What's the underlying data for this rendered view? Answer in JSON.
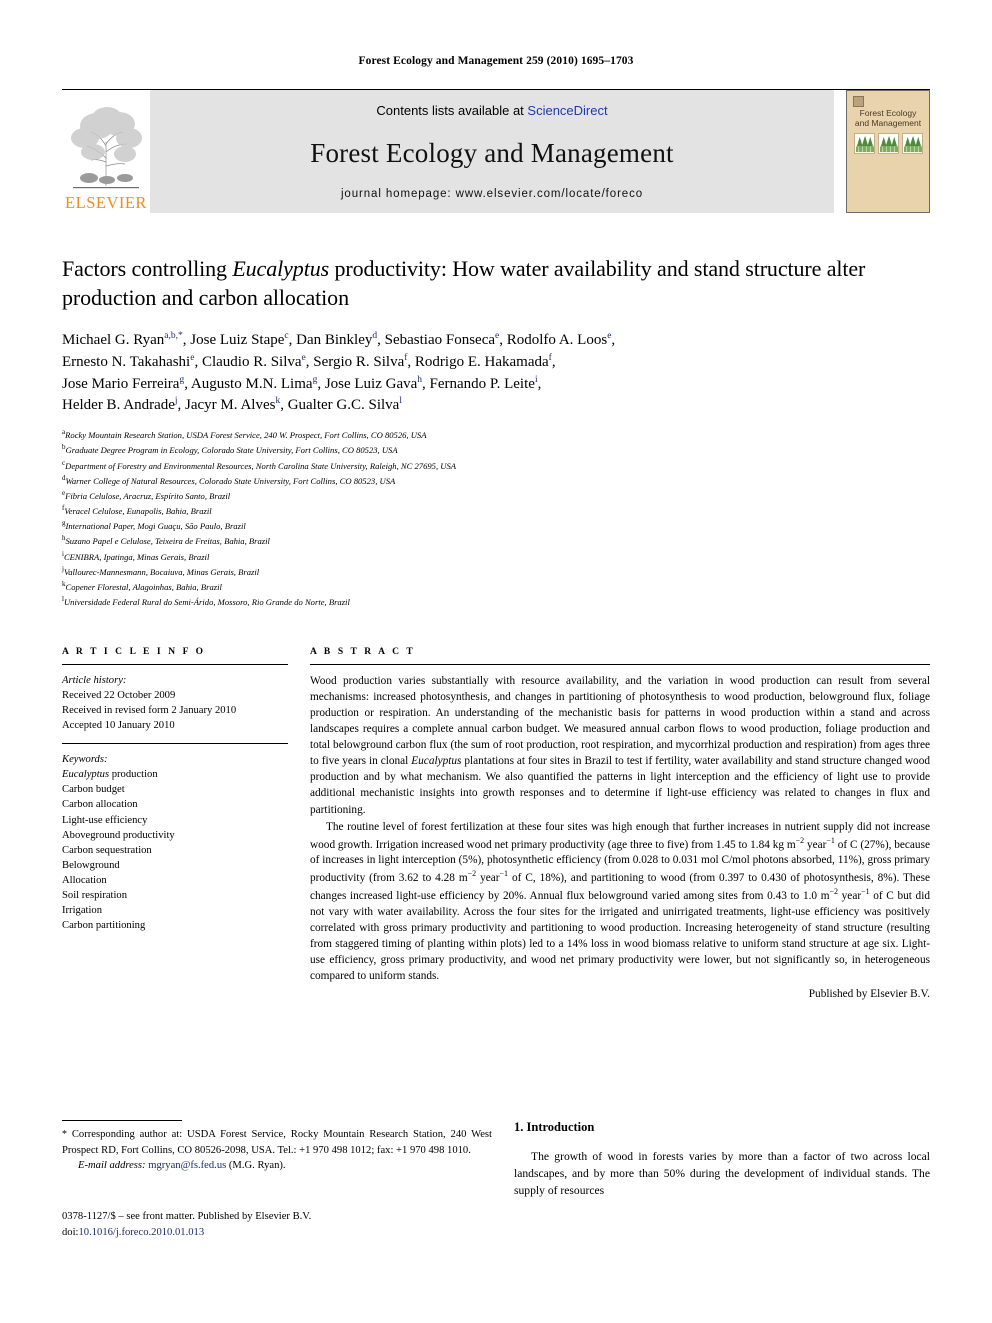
{
  "running_head": "Forest Ecology and Management 259 (2010) 1695–1703",
  "masthead": {
    "contents_prefix": "Contents lists available at ",
    "sciencedirect": "ScienceDirect",
    "journal_title": "Forest Ecology and Management",
    "homepage": "journal homepage: www.elsevier.com/locate/foreco",
    "publisher_logo_text": "ELSEVIER",
    "cover_title_line1": "Forest Ecology",
    "cover_title_line2": "and Management",
    "accent_orange": "#F08C1E",
    "link_blue": "#1a3fa0",
    "band_gray": "#e3e3e3",
    "cover_tan": "#e8d3ad"
  },
  "article": {
    "title_part1": "Factors controlling ",
    "title_italic": "Eucalyptus",
    "title_part2": " productivity: How water availability and stand structure alter production and carbon allocation",
    "authors_line1_a": "Michael G. Ryan",
    "authors_line1_a_sup": "a,b,*",
    "authors_line1_b": ", Jose Luiz Stape",
    "authors_line1_b_sup": "c",
    "authors_line1_c": ", Dan Binkley",
    "authors_line1_c_sup": "d",
    "authors_line1_d": ", Sebastiao Fonseca",
    "authors_line1_d_sup": "e",
    "authors_line1_e": ", Rodolfo A. Loos",
    "authors_line1_e_sup": "e",
    "authors_line1_end": ",",
    "authors_line2_a": "Ernesto N. Takahashi",
    "authors_line2_a_sup": "e",
    "authors_line2_b": ", Claudio R. Silva",
    "authors_line2_b_sup": "e",
    "authors_line2_c": ", Sergio R. Silva",
    "authors_line2_c_sup": "f",
    "authors_line2_d": ", Rodrigo E. Hakamada",
    "authors_line2_d_sup": "f",
    "authors_line2_end": ",",
    "authors_line3_a": "Jose Mario Ferreira",
    "authors_line3_a_sup": "g",
    "authors_line3_b": ", Augusto M.N. Lima",
    "authors_line3_b_sup": "g",
    "authors_line3_c": ", Jose Luiz Gava",
    "authors_line3_c_sup": "h",
    "authors_line3_d": ", Fernando P. Leite",
    "authors_line3_d_sup": "i",
    "authors_line3_end": ",",
    "authors_line4_a": "Helder B. Andrade",
    "authors_line4_a_sup": "j",
    "authors_line4_b": ", Jacyr M. Alves",
    "authors_line4_b_sup": "k",
    "authors_line4_c": ", Gualter G.C. Silva",
    "authors_line4_c_sup": "l"
  },
  "affiliations": [
    {
      "marker": "a",
      "text": "Rocky Mountain Research Station, USDA Forest Service, 240 W. Prospect, Fort Collins, CO 80526, USA"
    },
    {
      "marker": "b",
      "text": "Graduate Degree Program in Ecology, Colorado State University, Fort Collins, CO 80523, USA"
    },
    {
      "marker": "c",
      "text": "Department of Forestry and Environmental Resources, North Carolina State University, Raleigh, NC 27695, USA"
    },
    {
      "marker": "d",
      "text": "Warner College of Natural Resources, Colorado State University, Fort Collins, CO 80523, USA"
    },
    {
      "marker": "e",
      "text": "Fibria Celulose, Aracruz, Espírito Santo, Brazil"
    },
    {
      "marker": "f",
      "text": "Veracel Celulose, Eunapolis, Bahia, Brazil"
    },
    {
      "marker": "g",
      "text": "International Paper, Mogi Guaçu, São Paulo, Brazil"
    },
    {
      "marker": "h",
      "text": "Suzano Papel e Celulose, Teixeira de Freitas, Bahia, Brazil"
    },
    {
      "marker": "i",
      "text": "CENIBRA, Ipatinga, Minas Gerais, Brazil"
    },
    {
      "marker": "j",
      "text": "Vallourec-Mannesmann, Bocaiuva, Minas Gerais, Brazil"
    },
    {
      "marker": "k",
      "text": "Copener Florestal, Alagoinhas, Bahia, Brazil"
    },
    {
      "marker": "l",
      "text": "Universidade Federal Rural do Semi-Árido, Mossoro, Rio Grande do Norte, Brazil"
    }
  ],
  "article_info": {
    "heading": "A R T I C L E   I N F O",
    "history_label": "Article history:",
    "received": "Received 22 October 2009",
    "revised": "Received in revised form 2 January 2010",
    "accepted": "Accepted 10 January 2010",
    "keywords_label": "Keywords:",
    "keywords": [
      "Eucalyptus production",
      "Carbon budget",
      "Carbon allocation",
      "Light-use efficiency",
      "Aboveground productivity",
      "Carbon sequestration",
      "Belowground",
      "Allocation",
      "Soil respiration",
      "Irrigation",
      "Carbon partitioning"
    ]
  },
  "abstract": {
    "heading": "A B S T R A C T",
    "para1_a": "Wood production varies substantially with resource availability, and the variation in wood production can result from several mechanisms: increased photosynthesis, and changes in partitioning of photosynthesis to wood production, belowground flux, foliage production or respiration. An understanding of the mechanistic basis for patterns in wood production within a stand and across landscapes requires a complete annual carbon budget. We measured annual carbon flows to wood production, foliage production and total belowground carbon flux (the sum of root production, root respiration, and mycorrhizal production and respiration) from ages three to five years in clonal ",
    "para1_italic": "Eucalyptus",
    "para1_b": " plantations at four sites in Brazil to test if fertility, water availability and stand structure changed wood production and by what mechanism. We also quantified the patterns in light interception and the efficiency of light use to provide additional mechanistic insights into growth responses and to determine if light-use efficiency was related to changes in flux and partitioning.",
    "para2_a": "The routine level of forest fertilization at these four sites was high enough that further increases in nutrient supply did not increase wood growth. Irrigation increased wood net primary productivity (age three to five) from 1.45 to 1.84 kg m",
    "sup_m2": "−2",
    "para2_b": " year",
    "sup_y1": "−1",
    "para2_c": " of C (27%), because of increases in light interception (5%), photosynthetic efficiency (from 0.028 to 0.031 mol C/mol photons absorbed, 11%), gross primary productivity (from 3.62 to 4.28 m",
    "para2_d": " year",
    "para2_e": " of C, 18%), and partitioning to wood (from 0.397 to 0.430 of photosynthesis, 8%). These changes increased light-use efficiency by 20%. Annual flux belowground varied among sites from 0.43 to 1.0 m",
    "para2_f": " year",
    "para2_g": " of C but did not vary with water availability. Across the four sites for the irrigated and unirrigated treatments, light-use efficiency was positively correlated with gross primary productivity and partitioning to wood production. Increasing heterogeneity of stand structure (resulting from staggered timing of planting within plots) led to a 14% loss in wood biomass relative to uniform stand structure at age six. Light-use efficiency, gross primary productivity, and wood net primary productivity were lower, but not significantly so, in heterogeneous compared to uniform stands.",
    "published_by": "Published by Elsevier B.V."
  },
  "corresponding": {
    "star": "*",
    "text": "Corresponding author at: USDA Forest Service, Rocky Mountain Research Station, 240 West Prospect RD, Fort Collins, CO 80526-2098, USA. Tel.: +1 970 498 1012; fax: +1 970 498 1010.",
    "email_label": "E-mail address:",
    "email": "mgryan@fs.fed.us",
    "email_owner": "(M.G. Ryan)."
  },
  "front_matter": {
    "line1": "0378-1127/$ – see front matter. Published by Elsevier B.V.",
    "doi_label": "doi:",
    "doi_value": "10.1016/j.foreco.2010.01.013"
  },
  "introduction": {
    "heading": "1. Introduction",
    "para1": "The growth of wood in forests varies by more than a factor of two across local landscapes, and by more than 50% during the development of individual stands. The supply of resources"
  }
}
